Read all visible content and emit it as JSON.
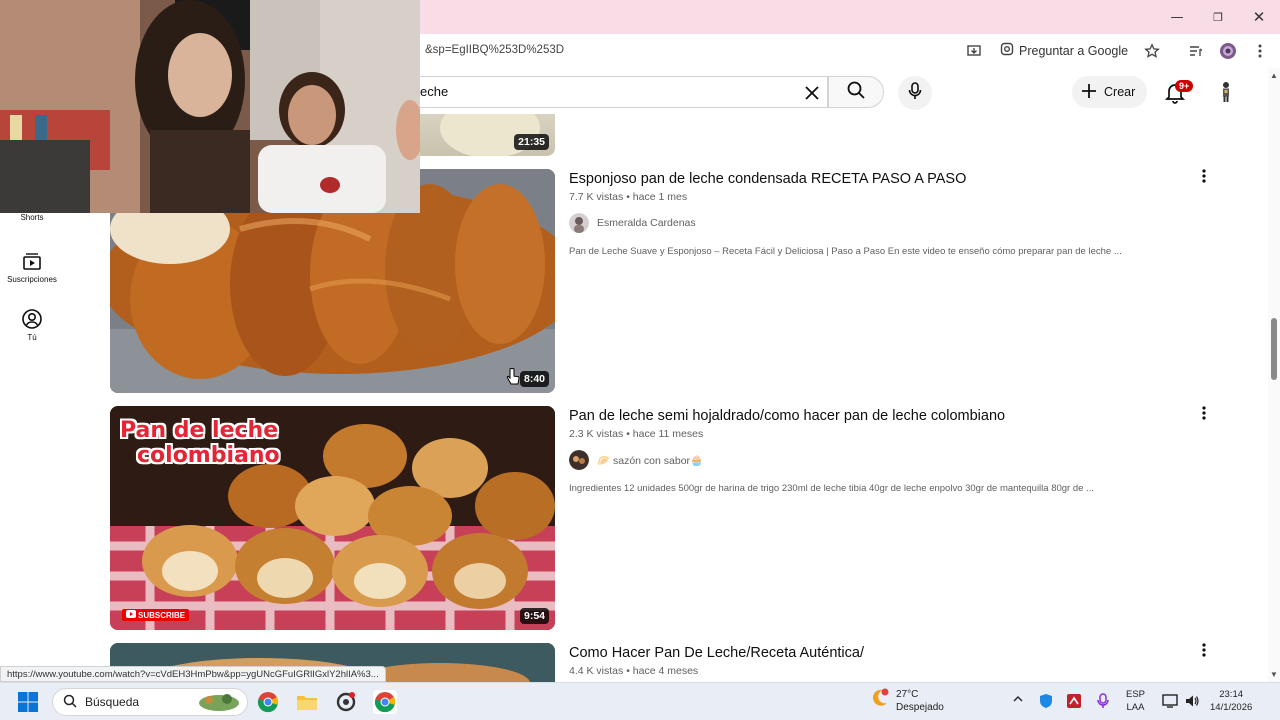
{
  "browser": {
    "url_fragment": "&sp=EgIIBQ%253D%253D",
    "ask_google_label": "Preguntar a Google"
  },
  "youtube": {
    "search_query_visible": "eche",
    "create_label": "Crear",
    "notifications_badge": "9+"
  },
  "guide": [
    {
      "label": "Shorts",
      "icon": "shorts-icon"
    },
    {
      "label": "Suscripciones",
      "icon": "subscriptions-icon"
    },
    {
      "label": "Tú",
      "icon": "you-icon"
    }
  ],
  "results": [
    {
      "duration": "21:35"
    },
    {
      "title": "Esponjoso pan de leche condensada RECETA PASO A PASO",
      "meta": "7.7 K vistas • hace 1 mes",
      "channel": "Esmeralda Cardenas",
      "description": "Pan de Leche Suave y Esponjoso – Receta Fácil y Deliciosa | Paso a Paso En este video te enseño cómo preparar pan de leche ...",
      "duration": "8:40"
    },
    {
      "title": "Pan de leche semi hojaldrado/como hacer pan de leche colombiano",
      "meta": "2.3 K vistas • hace 11 meses",
      "channel": "🥟 sazón con sabor🧁",
      "description": "Ingredientes 12 unidades 500gr de harina de trigo 230ml de leche tibia 40gr de leche enpolvo 30gr de mantequilla 80gr de ...",
      "duration": "9:54",
      "thumb_text_line1": "Pan de leche",
      "thumb_text_line2": "colombiano",
      "thumb_badge": "SUBSCRIBE"
    },
    {
      "title": "Como Hacer Pan De Leche/Receta Auténtica/",
      "meta": "4.4 K vistas • hace 4 meses"
    }
  ],
  "status_url": "https://www.youtube.com/watch?v=cVdEH3HmPbw&pp=ygUNcGFuIGRlIGxlY2hlIA%3...",
  "taskbar": {
    "search_label": "Búsqueda",
    "weather_temp": "27°C",
    "weather_desc": "Despejado",
    "lang_line1": "ESP",
    "lang_line2": "LAA",
    "time": "23:14",
    "date": "14/1/2026"
  },
  "colors": {
    "title_bar": "#f9dde6",
    "youtube_red": "#ff0000",
    "notification_red": "#cc0000"
  }
}
